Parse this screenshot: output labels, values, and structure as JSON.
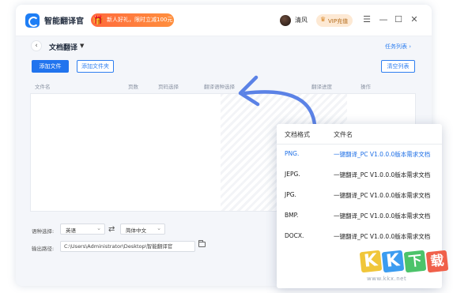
{
  "app": {
    "title": "智能翻译官",
    "promo_text": "新人好礼，限时立减100元",
    "promo_icon": "gift-icon",
    "user_name": "清风",
    "vip_label": "VIP充值",
    "window_controls": [
      "☰",
      "—",
      "☐",
      "✕"
    ]
  },
  "page": {
    "back": "‹",
    "title": "文档翻译",
    "title_caret": "▼",
    "task_list": "任务列表 ›"
  },
  "toolbar": {
    "add_file": "添加文件",
    "add_folder": "添加文件夹",
    "clear_list": "清空列表"
  },
  "table": {
    "columns": [
      "文件名",
      "页数",
      "页码选择",
      "翻译语种选择",
      "翻译进度",
      "操作"
    ]
  },
  "settings": {
    "language_label": "语种选择:",
    "source_lang": "英语",
    "swap": "⇄",
    "target_lang": "简体中文",
    "output_label": "输出路径:",
    "output_path": "C:\\Users\\Administrator\\Desktop\\智能翻译官"
  },
  "popup": {
    "header_format": "文档格式",
    "header_name": "文件名",
    "rows": [
      {
        "format": "PNG.",
        "name": "一键翻译_PC V1.0.0.0版本需求文档"
      },
      {
        "format": "JEPG.",
        "name": "一键翻译_PC V1.0.0.0版本需求文档"
      },
      {
        "format": "JPG.",
        "name": "一键翻译_PC V1.0.0.0版本需求文档"
      },
      {
        "format": "BMP.",
        "name": "一键翻译_PC V1.0.0.0版本需求文档"
      },
      {
        "format": "DOCX.",
        "name": "一键翻译_PC V1.0.0.0版本需求文档"
      }
    ]
  },
  "watermark": {
    "letters": [
      "K",
      "K",
      "下",
      "载"
    ],
    "url": "www.kkx.net"
  },
  "colors": {
    "accent": "#2174ee",
    "arrow": "#5b82e6",
    "promo": "#ff6a3d",
    "watermark_1": "#f0c63a",
    "watermark_2": "#3b9cf0",
    "watermark_3": "#4cc36a",
    "watermark_4": "#f0604a"
  }
}
